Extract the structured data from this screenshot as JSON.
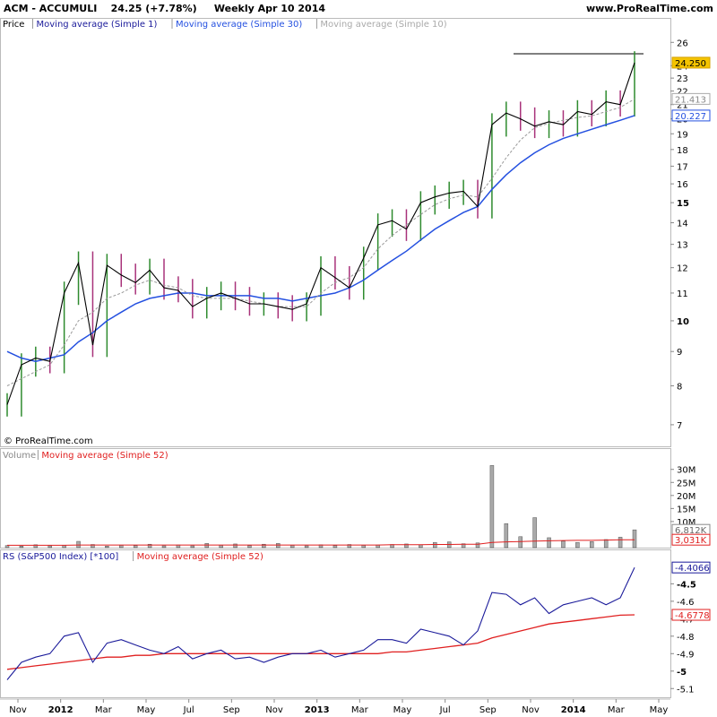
{
  "header": {
    "symbol": "ACM - ACCUMULI",
    "price_change": "24.25 (+7.78%)",
    "period": "Weekly  Apr 10 2014",
    "site": "www.ProRealTime.com"
  },
  "copyright": "© ProRealTime.com",
  "colors": {
    "up": "#2e8b2e",
    "down": "#a8327a",
    "close_line": "#000000",
    "ma10": "#999999",
    "ma30": "#2450e0",
    "rs": "#1a1a9a",
    "rs_ma": "#e02020",
    "volume_bar": "#999999",
    "volume_ma": "#e02020"
  },
  "price_panel": {
    "legend": [
      {
        "label": "Price",
        "color": "#000000"
      },
      {
        "label": "Moving average (Simple 1)",
        "color": "#1a1a9a"
      },
      {
        "label": "Moving average (Simple 30)",
        "color": "#2450e0"
      },
      {
        "label": "Moving average (Simple 10)",
        "color": "#aaaaaa"
      }
    ],
    "tag_close": "24.250",
    "tag_ma10": "21.413",
    "tag_ma30": "20.227",
    "y_ticks": [
      "26",
      "24",
      "23",
      "22",
      "21",
      "20",
      "19",
      "18",
      "17",
      "16",
      "15",
      "14",
      "13",
      "12",
      "11",
      "10",
      "9",
      "8",
      "7"
    ]
  },
  "volume_panel": {
    "legend": [
      {
        "label": "Volume",
        "color": "#888888"
      },
      {
        "label": "Moving average (Simple 52)",
        "color": "#e02020"
      }
    ],
    "tag_vol": "6,812K",
    "tag_ma": "3,031K",
    "y_ticks": [
      "30M",
      "25M",
      "20M",
      "15M",
      "10M"
    ]
  },
  "rs_panel": {
    "legend": [
      {
        "label": "RS (S&P500 Index) [*100]",
        "color": "#1a1a9a"
      },
      {
        "label": "Moving average (Simple 52)",
        "color": "#e02020"
      }
    ],
    "tag_rs": "-4.4066",
    "tag_ma": "-4.6778",
    "y_ticks": [
      "-4.5",
      "-4.6",
      "-4.7",
      "-4.8",
      "-4.9",
      "-5",
      "-5.1"
    ]
  },
  "x_labels": [
    "Nov",
    "2012",
    "Mar",
    "May",
    "Jul",
    "Sep",
    "Nov",
    "2013",
    "Mar",
    "May",
    "Jul",
    "Sep",
    "Nov",
    "2014",
    "Mar",
    "May"
  ],
  "chart_data": [
    {
      "type": "line",
      "title": "ACM weekly price",
      "x": [
        "2011-10-06",
        "2011-10-27",
        "2011-11-17",
        "2011-12-08",
        "2011-12-29",
        "2012-01-19",
        "2012-02-09",
        "2012-03-01",
        "2012-03-22",
        "2012-04-12",
        "2012-05-03",
        "2012-05-24",
        "2012-06-14",
        "2012-07-05",
        "2012-07-26",
        "2012-08-16",
        "2012-09-06",
        "2012-09-27",
        "2012-10-18",
        "2012-11-08",
        "2012-11-29",
        "2012-12-20",
        "2013-01-10",
        "2013-01-31",
        "2013-02-21",
        "2013-03-14",
        "2013-04-04",
        "2013-04-25",
        "2013-05-16",
        "2013-06-06",
        "2013-06-27",
        "2013-07-18",
        "2013-08-08",
        "2013-08-29",
        "2013-09-19",
        "2013-10-10",
        "2013-10-31",
        "2013-11-21",
        "2013-12-12",
        "2014-01-02",
        "2014-01-23",
        "2014-02-13",
        "2014-03-06",
        "2014-03-27",
        "2014-04-10"
      ],
      "series": [
        {
          "name": "Price (close)",
          "values": [
            7.5,
            8.6,
            8.8,
            8.7,
            11.0,
            12.2,
            9.2,
            12.1,
            11.7,
            11.4,
            11.9,
            11.2,
            11.1,
            10.5,
            10.8,
            11.0,
            10.8,
            10.6,
            10.6,
            10.5,
            10.4,
            10.6,
            12.0,
            11.6,
            11.2,
            12.4,
            13.9,
            14.1,
            13.7,
            15.0,
            15.3,
            15.5,
            15.6,
            14.8,
            19.6,
            20.4,
            20.0,
            19.5,
            19.8,
            19.6,
            20.5,
            20.3,
            21.2,
            21.0,
            24.25
          ]
        },
        {
          "name": "Moving average (Simple 10)",
          "values": [
            8.0,
            8.2,
            8.4,
            8.6,
            9.2,
            10.0,
            10.3,
            10.8,
            11.0,
            11.3,
            11.5,
            11.3,
            11.2,
            10.9,
            10.8,
            10.8,
            10.8,
            10.7,
            10.6,
            10.5,
            10.5,
            10.5,
            11.0,
            11.4,
            11.6,
            12.0,
            12.8,
            13.4,
            13.9,
            14.4,
            14.9,
            15.2,
            15.4,
            15.3,
            16.3,
            17.5,
            18.6,
            19.4,
            19.7,
            19.9,
            20.1,
            20.2,
            20.5,
            20.8,
            21.413
          ]
        },
        {
          "name": "Moving average (Simple 30)",
          "values": [
            9.0,
            8.8,
            8.7,
            8.8,
            8.9,
            9.3,
            9.6,
            10.0,
            10.3,
            10.6,
            10.8,
            10.9,
            11.0,
            11.0,
            10.9,
            10.9,
            10.9,
            10.9,
            10.8,
            10.8,
            10.7,
            10.8,
            10.9,
            11.0,
            11.2,
            11.5,
            11.9,
            12.3,
            12.7,
            13.2,
            13.7,
            14.1,
            14.5,
            14.8,
            15.7,
            16.5,
            17.2,
            17.8,
            18.3,
            18.7,
            19.0,
            19.3,
            19.6,
            19.9,
            20.227
          ]
        }
      ],
      "ylim": [
        6.5,
        27
      ],
      "resistance_level": 25
    },
    {
      "type": "bar",
      "title": "Volume",
      "series": [
        {
          "name": "Volume",
          "unit": "M",
          "values": [
            0.8,
            0.6,
            1.1,
            0.7,
            0.9,
            2.4,
            1.2,
            0.6,
            0.9,
            0.8,
            1.3,
            0.7,
            1.0,
            0.7,
            1.6,
            0.9,
            1.4,
            0.8,
            1.3,
            1.6,
            0.9,
            0.7,
            1.1,
            0.8,
            1.2,
            0.9,
            1.0,
            1.2,
            1.4,
            1.1,
            2.0,
            2.2,
            1.5,
            1.8,
            31.5,
            9.2,
            4.2,
            11.5,
            3.8,
            2.5,
            2.0,
            2.3,
            3.1,
            4.0,
            6.812
          ]
        },
        {
          "name": "Moving average (Simple 52)",
          "unit": "M",
          "values": [
            0.9,
            0.9,
            0.9,
            0.9,
            0.9,
            1.0,
            1.0,
            1.0,
            1.0,
            1.0,
            1.0,
            1.0,
            1.0,
            1.0,
            1.0,
            1.0,
            1.0,
            1.0,
            1.0,
            1.0,
            1.0,
            1.0,
            1.0,
            1.0,
            1.0,
            1.0,
            1.0,
            1.1,
            1.1,
            1.1,
            1.2,
            1.2,
            1.3,
            1.3,
            2.0,
            2.2,
            2.3,
            2.5,
            2.6,
            2.7,
            2.8,
            2.8,
            2.9,
            3.0,
            3.031
          ]
        }
      ],
      "ylim": [
        0,
        33
      ]
    },
    {
      "type": "line",
      "title": "RS (S&P500 Index) [*100]",
      "series": [
        {
          "name": "RS (S&P500 Index) [*100]",
          "values": [
            -5.05,
            -4.95,
            -4.92,
            -4.9,
            -4.8,
            -4.78,
            -4.95,
            -4.84,
            -4.82,
            -4.85,
            -4.88,
            -4.9,
            -4.86,
            -4.93,
            -4.9,
            -4.88,
            -4.93,
            -4.92,
            -4.95,
            -4.92,
            -4.9,
            -4.9,
            -4.88,
            -4.92,
            -4.9,
            -4.88,
            -4.82,
            -4.82,
            -4.84,
            -4.76,
            -4.78,
            -4.8,
            -4.85,
            -4.77,
            -4.55,
            -4.56,
            -4.62,
            -4.58,
            -4.67,
            -4.62,
            -4.6,
            -4.58,
            -4.62,
            -4.58,
            -4.4066
          ]
        },
        {
          "name": "Moving average (Simple 52)",
          "values": [
            -4.99,
            -4.98,
            -4.97,
            -4.96,
            -4.95,
            -4.94,
            -4.93,
            -4.92,
            -4.92,
            -4.91,
            -4.91,
            -4.9,
            -4.9,
            -4.9,
            -4.9,
            -4.9,
            -4.9,
            -4.9,
            -4.9,
            -4.9,
            -4.9,
            -4.9,
            -4.9,
            -4.9,
            -4.9,
            -4.9,
            -4.9,
            -4.89,
            -4.89,
            -4.88,
            -4.87,
            -4.86,
            -4.85,
            -4.84,
            -4.81,
            -4.79,
            -4.77,
            -4.75,
            -4.73,
            -4.72,
            -4.71,
            -4.7,
            -4.69,
            -4.68,
            -4.6778
          ]
        }
      ],
      "ylim": [
        -5.15,
        -4.38
      ]
    }
  ]
}
